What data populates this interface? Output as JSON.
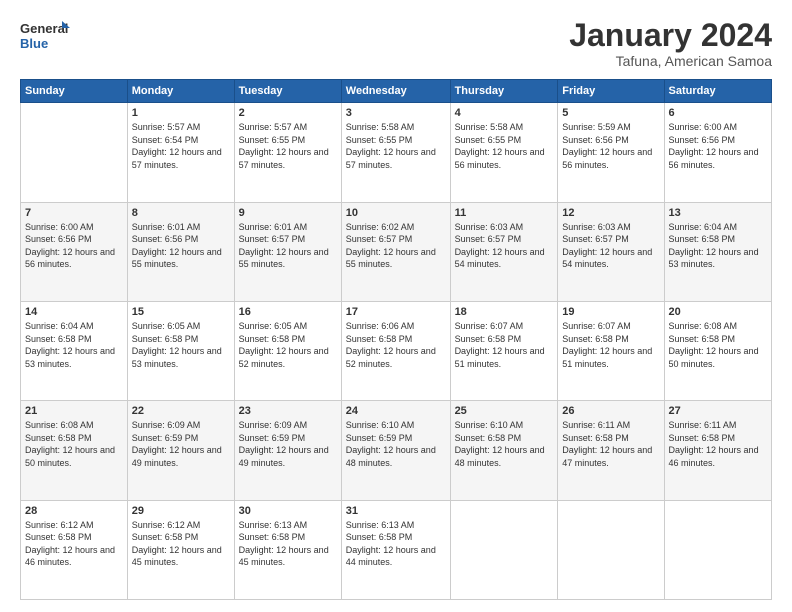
{
  "logo": {
    "line1": "General",
    "line2": "Blue"
  },
  "title": "January 2024",
  "subtitle": "Tafuna, American Samoa",
  "columns": [
    "Sunday",
    "Monday",
    "Tuesday",
    "Wednesday",
    "Thursday",
    "Friday",
    "Saturday"
  ],
  "weeks": [
    [
      {
        "day": "",
        "sunrise": "",
        "sunset": "",
        "daylight": ""
      },
      {
        "day": "1",
        "sunrise": "Sunrise: 5:57 AM",
        "sunset": "Sunset: 6:54 PM",
        "daylight": "Daylight: 12 hours and 57 minutes."
      },
      {
        "day": "2",
        "sunrise": "Sunrise: 5:57 AM",
        "sunset": "Sunset: 6:55 PM",
        "daylight": "Daylight: 12 hours and 57 minutes."
      },
      {
        "day": "3",
        "sunrise": "Sunrise: 5:58 AM",
        "sunset": "Sunset: 6:55 PM",
        "daylight": "Daylight: 12 hours and 57 minutes."
      },
      {
        "day": "4",
        "sunrise": "Sunrise: 5:58 AM",
        "sunset": "Sunset: 6:55 PM",
        "daylight": "Daylight: 12 hours and 56 minutes."
      },
      {
        "day": "5",
        "sunrise": "Sunrise: 5:59 AM",
        "sunset": "Sunset: 6:56 PM",
        "daylight": "Daylight: 12 hours and 56 minutes."
      },
      {
        "day": "6",
        "sunrise": "Sunrise: 6:00 AM",
        "sunset": "Sunset: 6:56 PM",
        "daylight": "Daylight: 12 hours and 56 minutes."
      }
    ],
    [
      {
        "day": "7",
        "sunrise": "Sunrise: 6:00 AM",
        "sunset": "Sunset: 6:56 PM",
        "daylight": "Daylight: 12 hours and 56 minutes."
      },
      {
        "day": "8",
        "sunrise": "Sunrise: 6:01 AM",
        "sunset": "Sunset: 6:56 PM",
        "daylight": "Daylight: 12 hours and 55 minutes."
      },
      {
        "day": "9",
        "sunrise": "Sunrise: 6:01 AM",
        "sunset": "Sunset: 6:57 PM",
        "daylight": "Daylight: 12 hours and 55 minutes."
      },
      {
        "day": "10",
        "sunrise": "Sunrise: 6:02 AM",
        "sunset": "Sunset: 6:57 PM",
        "daylight": "Daylight: 12 hours and 55 minutes."
      },
      {
        "day": "11",
        "sunrise": "Sunrise: 6:03 AM",
        "sunset": "Sunset: 6:57 PM",
        "daylight": "Daylight: 12 hours and 54 minutes."
      },
      {
        "day": "12",
        "sunrise": "Sunrise: 6:03 AM",
        "sunset": "Sunset: 6:57 PM",
        "daylight": "Daylight: 12 hours and 54 minutes."
      },
      {
        "day": "13",
        "sunrise": "Sunrise: 6:04 AM",
        "sunset": "Sunset: 6:58 PM",
        "daylight": "Daylight: 12 hours and 53 minutes."
      }
    ],
    [
      {
        "day": "14",
        "sunrise": "Sunrise: 6:04 AM",
        "sunset": "Sunset: 6:58 PM",
        "daylight": "Daylight: 12 hours and 53 minutes."
      },
      {
        "day": "15",
        "sunrise": "Sunrise: 6:05 AM",
        "sunset": "Sunset: 6:58 PM",
        "daylight": "Daylight: 12 hours and 53 minutes."
      },
      {
        "day": "16",
        "sunrise": "Sunrise: 6:05 AM",
        "sunset": "Sunset: 6:58 PM",
        "daylight": "Daylight: 12 hours and 52 minutes."
      },
      {
        "day": "17",
        "sunrise": "Sunrise: 6:06 AM",
        "sunset": "Sunset: 6:58 PM",
        "daylight": "Daylight: 12 hours and 52 minutes."
      },
      {
        "day": "18",
        "sunrise": "Sunrise: 6:07 AM",
        "sunset": "Sunset: 6:58 PM",
        "daylight": "Daylight: 12 hours and 51 minutes."
      },
      {
        "day": "19",
        "sunrise": "Sunrise: 6:07 AM",
        "sunset": "Sunset: 6:58 PM",
        "daylight": "Daylight: 12 hours and 51 minutes."
      },
      {
        "day": "20",
        "sunrise": "Sunrise: 6:08 AM",
        "sunset": "Sunset: 6:58 PM",
        "daylight": "Daylight: 12 hours and 50 minutes."
      }
    ],
    [
      {
        "day": "21",
        "sunrise": "Sunrise: 6:08 AM",
        "sunset": "Sunset: 6:58 PM",
        "daylight": "Daylight: 12 hours and 50 minutes."
      },
      {
        "day": "22",
        "sunrise": "Sunrise: 6:09 AM",
        "sunset": "Sunset: 6:59 PM",
        "daylight": "Daylight: 12 hours and 49 minutes."
      },
      {
        "day": "23",
        "sunrise": "Sunrise: 6:09 AM",
        "sunset": "Sunset: 6:59 PM",
        "daylight": "Daylight: 12 hours and 49 minutes."
      },
      {
        "day": "24",
        "sunrise": "Sunrise: 6:10 AM",
        "sunset": "Sunset: 6:59 PM",
        "daylight": "Daylight: 12 hours and 48 minutes."
      },
      {
        "day": "25",
        "sunrise": "Sunrise: 6:10 AM",
        "sunset": "Sunset: 6:58 PM",
        "daylight": "Daylight: 12 hours and 48 minutes."
      },
      {
        "day": "26",
        "sunrise": "Sunrise: 6:11 AM",
        "sunset": "Sunset: 6:58 PM",
        "daylight": "Daylight: 12 hours and 47 minutes."
      },
      {
        "day": "27",
        "sunrise": "Sunrise: 6:11 AM",
        "sunset": "Sunset: 6:58 PM",
        "daylight": "Daylight: 12 hours and 46 minutes."
      }
    ],
    [
      {
        "day": "28",
        "sunrise": "Sunrise: 6:12 AM",
        "sunset": "Sunset: 6:58 PM",
        "daylight": "Daylight: 12 hours and 46 minutes."
      },
      {
        "day": "29",
        "sunrise": "Sunrise: 6:12 AM",
        "sunset": "Sunset: 6:58 PM",
        "daylight": "Daylight: 12 hours and 45 minutes."
      },
      {
        "day": "30",
        "sunrise": "Sunrise: 6:13 AM",
        "sunset": "Sunset: 6:58 PM",
        "daylight": "Daylight: 12 hours and 45 minutes."
      },
      {
        "day": "31",
        "sunrise": "Sunrise: 6:13 AM",
        "sunset": "Sunset: 6:58 PM",
        "daylight": "Daylight: 12 hours and 44 minutes."
      },
      {
        "day": "",
        "sunrise": "",
        "sunset": "",
        "daylight": ""
      },
      {
        "day": "",
        "sunrise": "",
        "sunset": "",
        "daylight": ""
      },
      {
        "day": "",
        "sunrise": "",
        "sunset": "",
        "daylight": ""
      }
    ]
  ]
}
